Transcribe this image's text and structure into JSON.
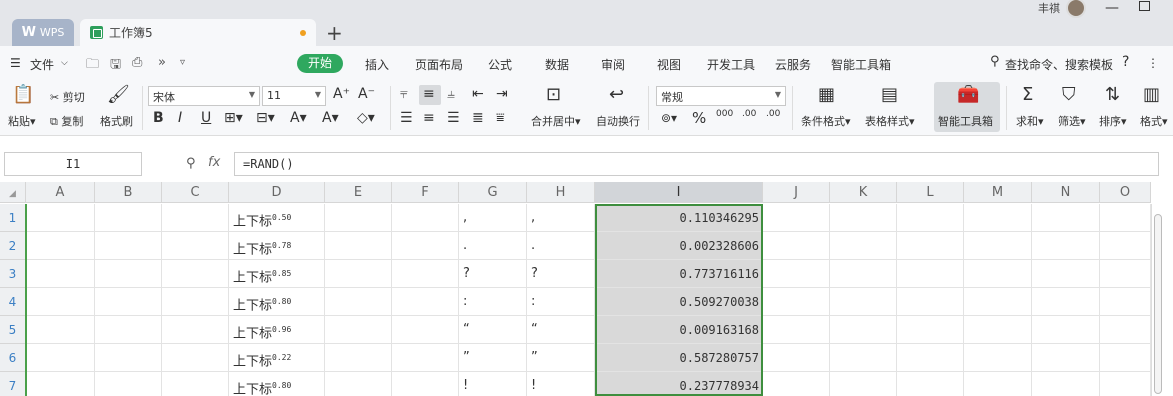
{
  "titlebar": {
    "wps_tab": "WPS",
    "doc_tab": "工作簿5",
    "new_tab": "+",
    "user": "丰祺"
  },
  "menu": {
    "file": "文件",
    "start": "开始",
    "items": [
      "插入",
      "页面布局",
      "公式",
      "数据",
      "审阅",
      "视图",
      "开发工具",
      "云服务",
      "智能工具箱"
    ],
    "search": "查找命令、搜索模板",
    "help": "?"
  },
  "toolbar": {
    "paste": "粘贴",
    "cut": "剪切",
    "copy": "复制",
    "format_painter": "格式刷",
    "font": "宋体",
    "font_size": "11",
    "merge_center": "合并居中",
    "wrap": "自动换行",
    "number_format": "常规",
    "cond_format": "条件格式",
    "table_style": "表格样式",
    "smart_tools": "智能工具箱",
    "sum": "求和",
    "filter": "筛选",
    "sort": "排序",
    "format": "格式"
  },
  "formula": {
    "cell_ref": "I1",
    "fx": "fx",
    "value": "=RAND()"
  },
  "columns": [
    "A",
    "B",
    "C",
    "D",
    "E",
    "F",
    "G",
    "H",
    "I",
    "J",
    "K",
    "L",
    "M",
    "N",
    "O"
  ],
  "rows": [
    {
      "num": "1",
      "d": "上下标",
      "d_sup": "0.50",
      "g": ",",
      "h": ",",
      "i": "0.110346295"
    },
    {
      "num": "2",
      "d": "上下标",
      "d_sup": "0.78",
      "g": ".",
      "h": ".",
      "i": "0.002328606"
    },
    {
      "num": "3",
      "d": "上下标",
      "d_sup": "0.85",
      "g": "?",
      "h": "?",
      "i": "0.773716116"
    },
    {
      "num": "4",
      "d": "上下标",
      "d_sup": "0.80",
      "g": ":",
      "h": ":",
      "i": "0.509270038"
    },
    {
      "num": "5",
      "d": "上下标",
      "d_sup": "0.96",
      "g": "“",
      "h": "“",
      "i": "0.009163168"
    },
    {
      "num": "6",
      "d": "上下标",
      "d_sup": "0.22",
      "g": "”",
      "h": "”",
      "i": "0.587280757"
    },
    {
      "num": "7",
      "d": "上下标",
      "d_sup": "0.80",
      "g": "!",
      "h": "!",
      "i": "0.237778934"
    }
  ]
}
